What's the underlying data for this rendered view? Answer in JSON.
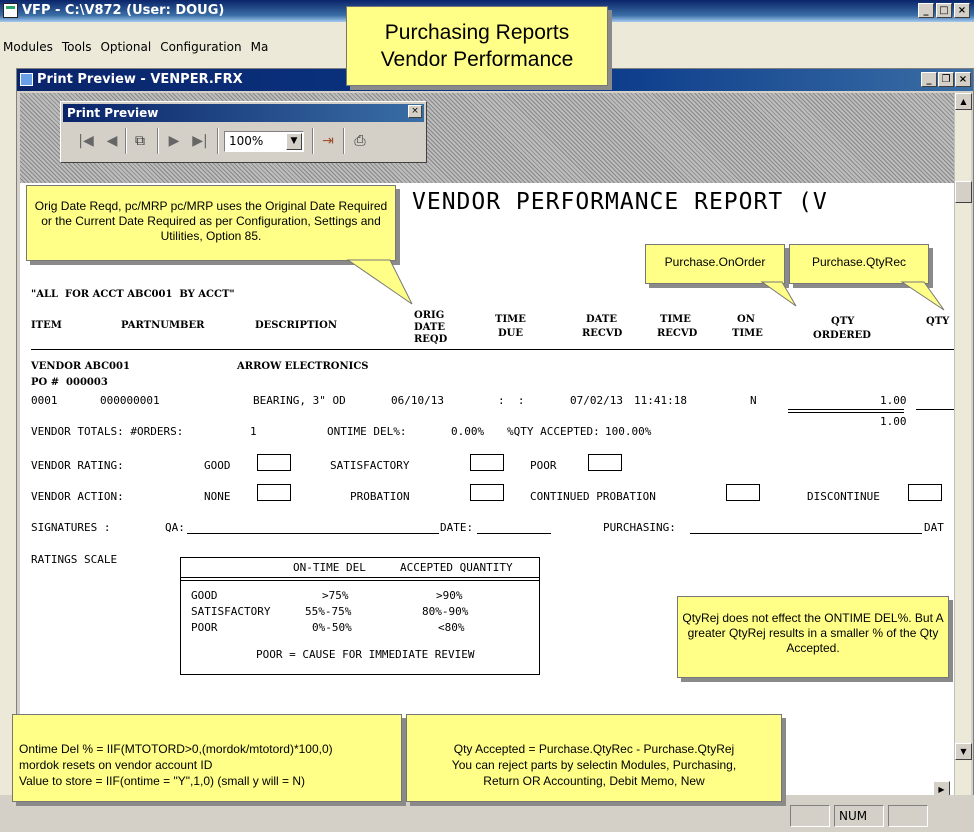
{
  "app": {
    "title": "VFP - C:\\V872 (User: DOUG)"
  },
  "menu": [
    "Modules",
    "Tools",
    "Optional",
    "Configuration",
    "Ma"
  ],
  "child": {
    "title": "Print Preview - VENPER.FRX"
  },
  "toolbar": {
    "title": "Print Preview",
    "zoom": "100%"
  },
  "report": {
    "title": "VENDOR PERFORMANCE REPORT (V",
    "filter": "\"ALL  FOR ACCT ABC001  BY ACCT\"",
    "headers": {
      "item": "ITEM",
      "partnumber": "PARTNUMBER",
      "description": "DESCRIPTION",
      "orig1": "ORIG",
      "orig2": "DATE",
      "orig3": "REQD",
      "timedue1": "TIME",
      "timedue2": "DUE",
      "daterecvd1": "DATE",
      "daterecvd2": "RECVD",
      "timerecvd1": "TIME",
      "timerecvd2": "RECVD",
      "ontime1": "ON",
      "ontime2": "TIME",
      "qty1": "QTY",
      "qty2": "ORDERED",
      "qtyx": "QTY"
    },
    "vendor_line": "VENDOR ABC001",
    "vendor_name": "ARROW ELECTRONICS",
    "po_line": "PO #  000003",
    "row": {
      "item": "0001",
      "part": "000000001",
      "desc": "BEARING, 3\" OD",
      "orig": "06/10/13",
      "timedue": ":  :",
      "daterecvd": "07/02/13",
      "timerecvd": "11:41:18",
      "ontime": "N",
      "qty": "1.00"
    },
    "totals": {
      "label": "VENDOR TOTALS: #ORDERS:",
      "orders": "1",
      "ontime_label": "ONTIME DEL%:",
      "ontime": "0.00%",
      "accepted_label": "%QTY ACCEPTED:",
      "accepted": "100.00%",
      "qty": "1.00"
    },
    "rating": {
      "label": "VENDOR RATING:",
      "good": "GOOD",
      "satisfactory": "SATISFACTORY",
      "poor": "POOR"
    },
    "action": {
      "label": "VENDOR ACTION:",
      "none": "NONE",
      "probation": "PROBATION",
      "continued": "CONTINUED PROBATION",
      "discontinue": "DISCONTINUE"
    },
    "signatures": {
      "label": "SIGNATURES :",
      "qa": "QA:",
      "date": "DATE:",
      "purchasing": "PURCHASING:",
      "dat": "DAT"
    },
    "scale": {
      "label": "RATINGS SCALE",
      "col1": "ON-TIME DEL",
      "col2": "ACCEPTED QUANTITY",
      "rows": [
        {
          "name": "GOOD",
          "ontime": ">75%",
          "accepted": ">90%"
        },
        {
          "name": "SATISFACTORY",
          "ontime": "55%-75%",
          "accepted": "80%-90%"
        },
        {
          "name": "POOR",
          "ontime": "0%-50%",
          "accepted": "<80%"
        }
      ],
      "footer": "POOR = CAUSE FOR IMMEDIATE REVIEW"
    }
  },
  "callouts": {
    "header": "Purchasing Reports\nVendor Performance",
    "origdate": "Orig Date Reqd, pc/MRP pc/MRP uses the Original Date Required or the Current Date Required as per Configuration, Settings and Utilities, Option 85.",
    "onorder": "Purchase.OnOrder",
    "qtyrec": "Purchase.QtyRec",
    "qtyrej": "QtyRej does not effect the ONTIME DEL%. But A greater QtyRej results in a smaller % of the Qty Accepted.",
    "ontimeformula": "Ontime Del % = IIF(MTOTORD>0,(mordok/mtotord)*100,0)\nmordok resets on vendor account ID\nValue to store = IIF(ontime = \"Y\",1,0) (small y will = N)",
    "qtyaccepted": "Qty Accepted = Purchase.QtyRec - Purchase.QtyRej\nYou can reject parts by selectin Modules, Purchasing,\nReturn OR  Accounting, Debit Memo, New"
  },
  "status": {
    "num": "NUM"
  }
}
